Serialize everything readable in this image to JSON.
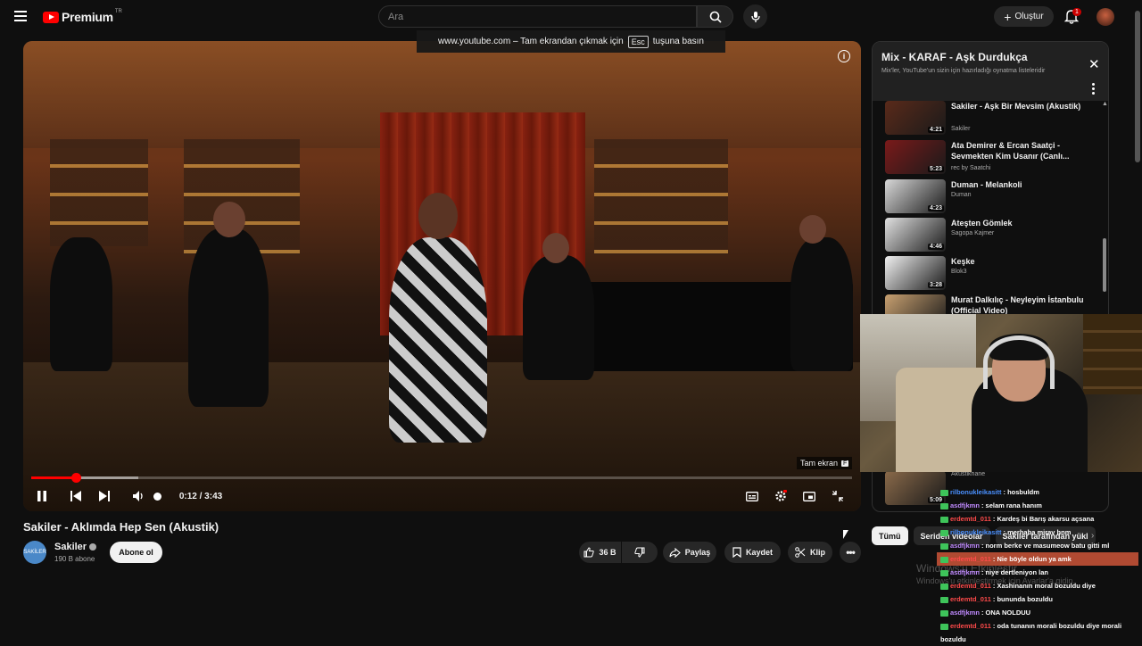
{
  "header": {
    "logo_text": "Premium",
    "logo_sup": "TR",
    "search_placeholder": "Ara",
    "create_label": "Oluştur",
    "notification_count": "1"
  },
  "fullscreen_toast": {
    "text_before": "www.youtube.com – Tam ekrandan çıkmak için",
    "key": "Esc",
    "text_after": "tuşuna basın"
  },
  "player": {
    "tooltip_label": "Tam ekran",
    "tooltip_key": "F",
    "current_time": "0:12",
    "duration": "3:43",
    "progress_fraction": 0.054,
    "buffer_fraction": 0.13
  },
  "video": {
    "title": "Sakiler - Aklımda Hep Sen (Akustik)",
    "channel_name": "Sakiler",
    "channel_avatar_text": "SAKİLER",
    "subscribers": "190 B abone",
    "subscribe_label": "Abone ol",
    "like_count": "36 B",
    "share_label": "Paylaş",
    "save_label": "Kaydet",
    "clip_label": "Klip"
  },
  "playlist": {
    "title": "Mix - KARAF - Aşk Durdukça",
    "subtitle": "Mix'ler, YouTube'un sizin için hazırladığı oynatma listeleridir",
    "items": [
      {
        "title": "Sakiler - Aşk Bir Mevsim (Akustik)",
        "artist": "Sakiler",
        "duration": "4:21",
        "color": "#5a2a1a"
      },
      {
        "title": "Ata Demirer & Ercan Saatçi - Sevmekten Kim Usanır (Canlı...",
        "artist": "rec by Saatchi",
        "duration": "5:23",
        "color": "#7a1a1a"
      },
      {
        "title": "Duman - Melankoli",
        "artist": "Duman",
        "duration": "4:23",
        "color": "#d8d8d8"
      },
      {
        "title": "Ateşten Gömlek",
        "artist": "Sagopa Kajmer",
        "duration": "4:46",
        "color": "#e0e0e0"
      },
      {
        "title": "Keşke",
        "artist": "Blok3",
        "duration": "3:28",
        "color": "#f0f0f0"
      },
      {
        "title": "Murat Dalkılıç - Neyleyim İstanbulu (Official Video)",
        "artist": "",
        "duration": "",
        "color": "#c8a070"
      },
      {
        "title": "",
        "artist": "Akustikhane",
        "duration": "5:09",
        "color": "#8a6a4a"
      }
    ]
  },
  "filters": {
    "chips": [
      "Tümü",
      "Seriden videolar",
      "Sakiler tarafından yükl"
    ]
  },
  "watermark": {
    "line1": "Windows'u Etkinleştir",
    "line2": "Windows'u etkinleştirmek için Ayarlar'a gidin."
  },
  "chat": {
    "messages": [
      {
        "user": "rilbonukleikasitt",
        "text": ": hosbuldm",
        "color": "#4a90ff",
        "highlight": false
      },
      {
        "user": "asdfjkmn",
        "text": ": selam rana hanım",
        "color": "#c08aff",
        "highlight": false
      },
      {
        "user": "erdemtd_011",
        "text": ": Kardeş bi Barış akarsu açsana",
        "color": "#ff4a4a",
        "highlight": false
      },
      {
        "user": "rilbonukleikasitt",
        "text": ": merhaba mirav hnm",
        "color": "#4a90ff",
        "highlight": false
      },
      {
        "user": "asdfjkmn",
        "text": ": norm berke ve masumeow batu gitti ml",
        "color": "#c08aff",
        "highlight": false
      },
      {
        "user": "erdemtd_011",
        "text": ": Nie böyle oldun ya amk",
        "color": "#ff4a4a",
        "highlight": true
      },
      {
        "user": "asdfjkmn",
        "text": ": niye dertleniyon lan",
        "color": "#c08aff",
        "highlight": false
      },
      {
        "user": "erdemtd_011",
        "text": ": Xashinanın moral bozuldu diye",
        "color": "#ff4a4a",
        "highlight": false
      },
      {
        "user": "erdemtd_011",
        "text": ": bununda bozuldu",
        "color": "#ff4a4a",
        "highlight": false
      },
      {
        "user": "asdfjkmn",
        "text": ": ONA NOLDUU",
        "color": "#c08aff",
        "highlight": false
      },
      {
        "user": "erdemtd_011",
        "text": ": oda tunanın morali bozuldu diye morali",
        "color": "#ff4a4a",
        "highlight": false
      },
      {
        "user": "",
        "text": "bozuldu",
        "color": "#ff4a4a",
        "highlight": false
      }
    ]
  }
}
